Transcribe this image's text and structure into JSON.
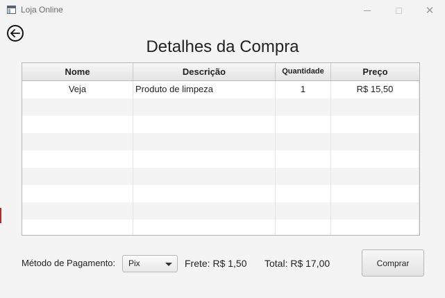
{
  "window": {
    "title": "Loja Online",
    "close_symbol": "✕"
  },
  "page": {
    "title": "Detalhes da Compra"
  },
  "table": {
    "headers": [
      "Nome",
      "Descrição",
      "Quantidade",
      "Preço"
    ],
    "rows": [
      [
        "Veja",
        "Produto de limpeza",
        "1",
        "R$ 15,50"
      ]
    ],
    "empty_rows": 8
  },
  "footer": {
    "payment_label": "Método de Pagamento:",
    "payment_selected": "Pix",
    "frete": "Frete: R$ 1,50",
    "total": "Total: R$ 17,00",
    "buy_label": "Comprar"
  },
  "icons": {
    "back": "arrow-left-circle-icon",
    "app": "app-window-icon",
    "dropdown": "chevron-down-icon"
  }
}
